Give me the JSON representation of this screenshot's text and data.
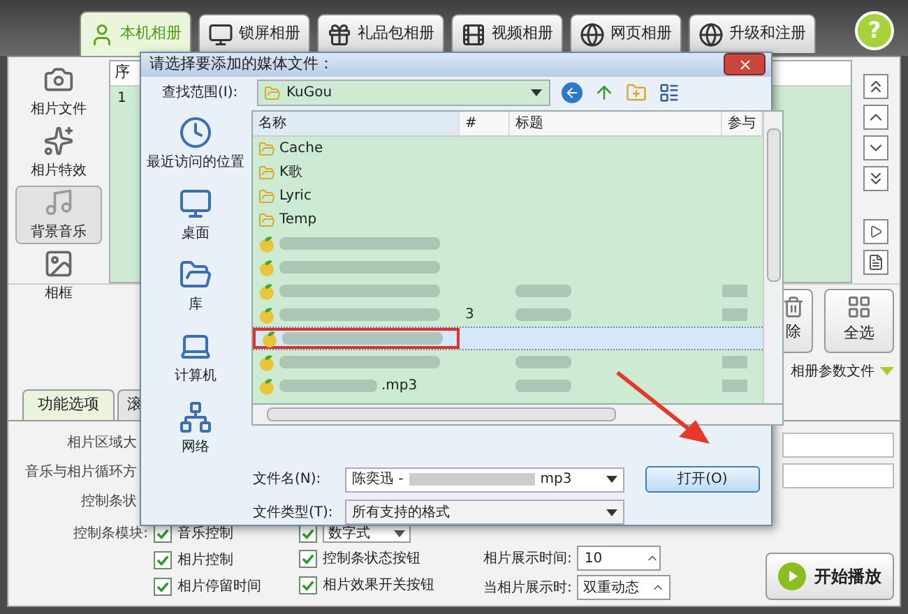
{
  "top_tabs": [
    {
      "label": "本机相册",
      "selected": true
    },
    {
      "label": "锁屏相册",
      "selected": false
    },
    {
      "label": "礼品包相册",
      "selected": false
    },
    {
      "label": "视频相册",
      "selected": false
    },
    {
      "label": "网页相册",
      "selected": false
    },
    {
      "label": "升级和注册",
      "selected": false
    }
  ],
  "help_button": "?",
  "sidebar": [
    {
      "label": "相片文件",
      "selected": false
    },
    {
      "label": "相片特效",
      "selected": false
    },
    {
      "label": "背景音乐",
      "selected": true
    },
    {
      "label": "相框",
      "selected": false
    }
  ],
  "photo_table": {
    "column_1": "序",
    "rows": [
      "1"
    ]
  },
  "action_buttons": [
    "除",
    "全选"
  ],
  "params_dropdown": "相册参数文件",
  "bottom_tabs": [
    {
      "label": "功能选项",
      "selected": true
    },
    {
      "label": "滚",
      "selected": false
    }
  ],
  "settings_labels": [
    "相片区域大",
    "音乐与相片循环方",
    "控制条状"
  ],
  "control_modules": {
    "label": "控制条模块:",
    "column_1": [
      {
        "label": "音乐控制",
        "checked": true
      },
      {
        "label": "相片控制",
        "checked": true
      },
      {
        "label": "相片停留时间",
        "checked": true
      }
    ],
    "column_2": [
      {
        "kind": "dropdown",
        "label": "数字式",
        "checked": true
      },
      {
        "kind": "checkbox",
        "label": "控制条状态按钮",
        "checked": true
      },
      {
        "kind": "checkbox",
        "label": "相片效果开关按钮",
        "checked": true
      }
    ]
  },
  "display_time": {
    "label": "相片展示时间:",
    "value": "10"
  },
  "when_display": {
    "label": "当相片展示时:",
    "value": "双重动态"
  },
  "play_button": "开始播放",
  "dialog": {
    "title": "请选择要添加的媒体文件：",
    "look_in_label": "查找范围(I):",
    "look_in_value": "KuGou",
    "places": [
      "最近访问的位置",
      "桌面",
      "库",
      "计算机",
      "网络"
    ],
    "columns": [
      "名称",
      "#",
      "标题",
      "参与"
    ],
    "files": [
      {
        "kind": "folder",
        "name": "Cache",
        "selected": false
      },
      {
        "kind": "folder",
        "name": "K歌",
        "selected": false
      },
      {
        "kind": "folder",
        "name": "Lyric",
        "selected": false
      },
      {
        "kind": "folder",
        "name": "Temp",
        "selected": false
      },
      {
        "kind": "music",
        "selected": false,
        "blurred_title": false
      },
      {
        "kind": "music",
        "selected": false,
        "blurred_title": false
      },
      {
        "kind": "music",
        "selected": false,
        "blurred_title": true
      },
      {
        "kind": "music",
        "number": "3",
        "selected": false,
        "blurred_title": true
      },
      {
        "kind": "music",
        "selected": true,
        "blurred_title": false
      },
      {
        "kind": "music",
        "selected": false,
        "blurred_title": true
      },
      {
        "kind": "music",
        "name": ".mp3",
        "selected": false,
        "blurred_title": true
      }
    ],
    "file_name_label": "文件名(N):",
    "file_name_prefix": "陈奕迅 -",
    "file_name_suffix": "mp3",
    "file_type_label": "文件类型(T):",
    "file_type_value": "所有支持的格式",
    "open_button": "打开(O)"
  }
}
